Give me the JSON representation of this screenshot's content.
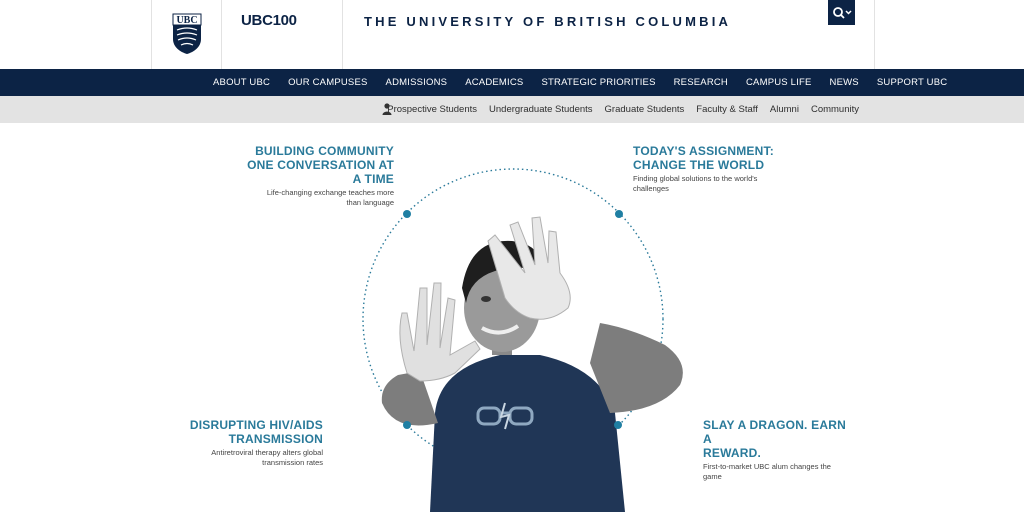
{
  "header": {
    "logo_text": "UBC",
    "centennial_text": "UBC100",
    "site_title": "THE UNIVERSITY OF BRITISH COLUMBIA",
    "search_icon": "search-icon"
  },
  "main_nav": {
    "items": [
      {
        "label": "ABOUT UBC"
      },
      {
        "label": "OUR CAMPUSES"
      },
      {
        "label": "ADMISSIONS"
      },
      {
        "label": "ACADEMICS"
      },
      {
        "label": "STRATEGIC PRIORITIES"
      },
      {
        "label": "RESEARCH"
      },
      {
        "label": "CAMPUS LIFE"
      },
      {
        "label": "NEWS"
      },
      {
        "label": "SUPPORT UBC"
      }
    ]
  },
  "audience_nav": {
    "icon": "person-icon",
    "items": [
      {
        "label": "Prospective Students"
      },
      {
        "label": "Undergraduate Students"
      },
      {
        "label": "Graduate Students"
      },
      {
        "label": "Faculty & Staff"
      },
      {
        "label": "Alumni"
      },
      {
        "label": "Community"
      }
    ]
  },
  "stories": [
    {
      "title_lines": [
        "BUILDING COMMUNITY",
        "ONE CONVERSATION AT",
        "A TIME"
      ],
      "summary_lines": [
        "Life-changing exchange teaches more",
        "than language"
      ]
    },
    {
      "title_lines": [
        "TODAY'S ASSIGNMENT:",
        "CHANGE THE WORLD"
      ],
      "summary_lines": [
        "Finding global solutions to the world's",
        "challenges"
      ]
    },
    {
      "title_lines": [
        "DISRUPTING HIV/AIDS",
        "TRANSMISSION"
      ],
      "summary_lines": [
        "Antiretroviral therapy alters global",
        "transmission rates"
      ]
    },
    {
      "title_lines": [
        "SLAY A DRAGON. EARN A",
        "REWARD."
      ],
      "summary_lines": [
        "First-to-market UBC alum changes the",
        "game"
      ]
    }
  ],
  "colors": {
    "navy": "#0c2345",
    "accent_teal": "#2a7a9a",
    "audience_bar": "#e3e3e3"
  }
}
